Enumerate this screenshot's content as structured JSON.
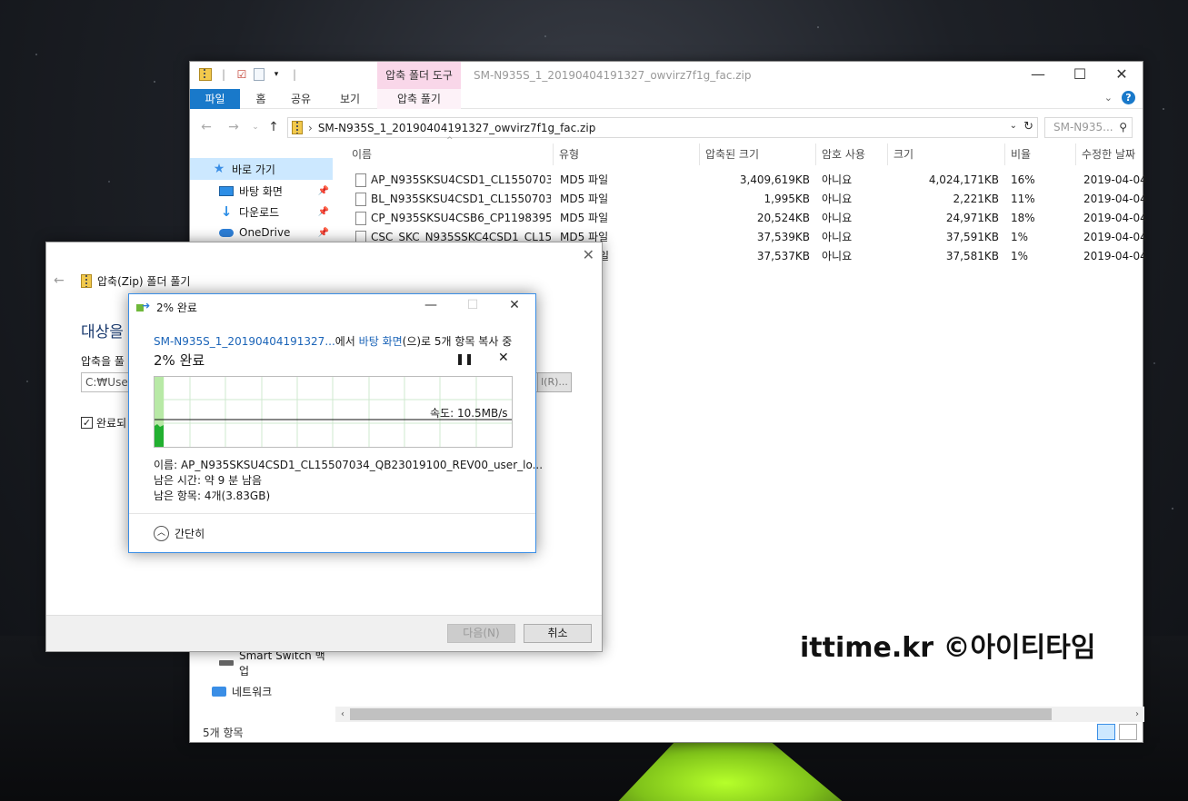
{
  "explorer": {
    "tool_tab": "압축 폴더 도구",
    "window_title": "SM-N935S_1_20190404191327_owvirz7f1g_fac.zip",
    "ribbon_tabs": [
      "파일",
      "홈",
      "공유",
      "보기",
      "압축 풀기"
    ],
    "address_path": "SM-N935S_1_20190404191327_owvirz7f1g_fac.zip",
    "search_placeholder": "SM-N935...",
    "nav": {
      "quick_access": "바로 가기",
      "desktop": "바탕 화면",
      "downloads": "다운로드",
      "onedrive": "OneDrive",
      "smart_switch": "Smart Switch 백업",
      "network": "네트워크"
    },
    "columns": [
      "이름",
      "유형",
      "압축된 크기",
      "암호 사용",
      "크기",
      "비율",
      "수정한 날짜"
    ],
    "files": [
      {
        "name": "AP_N935SKSU4CSD1_CL1550703...",
        "type": "MD5 파일",
        "compressed": "3,409,619KB",
        "encrypted": "아니요",
        "size": "4,024,171KB",
        "ratio": "16%",
        "date": "2019-04-04"
      },
      {
        "name": "BL_N935SKSU4CSD1_CL1550703...",
        "type": "MD5 파일",
        "compressed": "1,995KB",
        "encrypted": "아니요",
        "size": "2,221KB",
        "ratio": "11%",
        "date": "2019-04-04"
      },
      {
        "name": "CP_N935SKSU4CSB6_CP1198395...",
        "type": "MD5 파일",
        "compressed": "20,524KB",
        "encrypted": "아니요",
        "size": "24,971KB",
        "ratio": "18%",
        "date": "2019-04-04"
      },
      {
        "name": "CSC_SKC_N935SSKC4CSD1_CL15...",
        "type": "MD5 파일",
        "compressed": "37,539KB",
        "encrypted": "아니요",
        "size": "37,591KB",
        "ratio": "1%",
        "date": "2019-04-04"
      },
      {
        "name": "",
        "type": "일",
        "compressed": "37,537KB",
        "encrypted": "아니요",
        "size": "37,581KB",
        "ratio": "1%",
        "date": "2019-04-04"
      }
    ],
    "status": "5개 항목"
  },
  "wizard": {
    "title": "압축(Zip) 폴더 풀기",
    "heading": "대상을",
    "label": "압축을 풀",
    "path": "C:₩Users",
    "browse": "l(R)...",
    "check_label": "완료되",
    "next": "다음(N)",
    "cancel": "취소"
  },
  "progress": {
    "title": "2% 완료",
    "desc_source": "SM-N935S_1_20190404191327...",
    "desc_mid": "에서 ",
    "desc_dest": "바탕 화면",
    "desc_end": "(으)로 5개 항목 복사 중",
    "percent_text": "2% 완료",
    "percent": 2,
    "speed": "속도: 10.5MB/s",
    "name_line": "이름: AP_N935SKSU4CSD1_CL15507034_QB23019100_REV00_user_lo...",
    "time_line": "남은 시간: 약 9 분 남음",
    "items_line": "남은 항목: 4개(3.83GB)",
    "less_details": "간단히"
  },
  "watermark": "ittime.kr ©아이티타임",
  "colors": {
    "accent": "#1979ca",
    "tool_tab": "#f9d7e9",
    "graph_fill": "#22b030",
    "link": "#1b64b8"
  }
}
